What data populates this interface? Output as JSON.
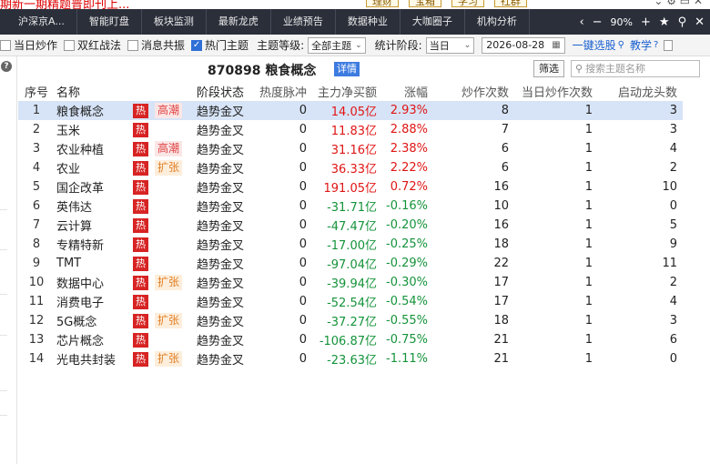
{
  "topbar": {
    "link": "期新一期精题普即刊上...",
    "buttons": [
      "理财",
      "宝箱",
      "学习",
      "社群"
    ]
  },
  "nav": {
    "tabs": [
      "沪深京A...",
      "智能盯盘",
      "板块监测",
      "最新龙虎",
      "业绩预告",
      "数据种业",
      "大咖圈子",
      "机构分析"
    ],
    "zoom": "90%"
  },
  "toolbar": {
    "checkboxes": [
      {
        "label": "当日炒作",
        "checked": false
      },
      {
        "label": "双红战法",
        "checked": false
      },
      {
        "label": "消息共振",
        "checked": false
      },
      {
        "label": "热门主题",
        "checked": true
      }
    ],
    "level_label": "主题等级:",
    "level_value": "全部主题",
    "stage_label": "统计阶段:",
    "stage_value": "当日",
    "date_value": "2026-08-28",
    "pick_label": "一键选股",
    "teach_label": "教学"
  },
  "title": {
    "text": "870898 粮食概念",
    "detail": "详情",
    "filter": "筛选",
    "search_placeholder": "搜索主题名称"
  },
  "table": {
    "headers": [
      "序号",
      "名称",
      "",
      "",
      "阶段状态",
      "热度脉冲",
      "主力净买额",
      "涨幅",
      "炒作次数",
      "当日炒作次数",
      "启动龙头数"
    ],
    "rows": [
      {
        "idx": "1",
        "name": "粮食概念",
        "hot": "热",
        "stage": "高潮",
        "stage_type": "hi",
        "status": "趋势金叉",
        "pulse": "0",
        "net": "14.05亿",
        "pct": "2.93%",
        "dir": "up",
        "times": "8",
        "today": "1",
        "leaders": "3",
        "selected": true
      },
      {
        "idx": "2",
        "name": "玉米",
        "hot": "热",
        "stage": "",
        "stage_type": "",
        "status": "趋势金叉",
        "pulse": "0",
        "net": "11.83亿",
        "pct": "2.88%",
        "dir": "up",
        "times": "7",
        "today": "1",
        "leaders": "3"
      },
      {
        "idx": "3",
        "name": "农业种植",
        "hot": "热",
        "stage": "高潮",
        "stage_type": "hi",
        "status": "趋势金叉",
        "pulse": "0",
        "net": "31.16亿",
        "pct": "2.38%",
        "dir": "up",
        "times": "6",
        "today": "1",
        "leaders": "4"
      },
      {
        "idx": "4",
        "name": "农业",
        "hot": "热",
        "stage": "扩张",
        "stage_type": "ex",
        "status": "趋势金叉",
        "pulse": "0",
        "net": "36.33亿",
        "pct": "2.22%",
        "dir": "up",
        "times": "6",
        "today": "1",
        "leaders": "2"
      },
      {
        "idx": "5",
        "name": "国企改革",
        "hot": "热",
        "stage": "",
        "stage_type": "",
        "status": "趋势金叉",
        "pulse": "0",
        "net": "191.05亿",
        "pct": "0.72%",
        "dir": "up",
        "times": "16",
        "today": "1",
        "leaders": "10"
      },
      {
        "idx": "6",
        "name": "英伟达",
        "hot": "热",
        "stage": "",
        "stage_type": "",
        "status": "趋势金叉",
        "pulse": "0",
        "net": "-31.71亿",
        "pct": "-0.16%",
        "dir": "down",
        "times": "10",
        "today": "1",
        "leaders": "0"
      },
      {
        "idx": "7",
        "name": "云计算",
        "hot": "热",
        "stage": "",
        "stage_type": "",
        "status": "趋势金叉",
        "pulse": "0",
        "net": "-47.47亿",
        "pct": "-0.20%",
        "dir": "down",
        "times": "16",
        "today": "1",
        "leaders": "5"
      },
      {
        "idx": "8",
        "name": "专精特新",
        "hot": "热",
        "stage": "",
        "stage_type": "",
        "status": "趋势金叉",
        "pulse": "0",
        "net": "-17.00亿",
        "pct": "-0.25%",
        "dir": "down",
        "times": "18",
        "today": "1",
        "leaders": "9"
      },
      {
        "idx": "9",
        "name": "TMT",
        "hot": "热",
        "stage": "",
        "stage_type": "",
        "status": "趋势金叉",
        "pulse": "0",
        "net": "-97.04亿",
        "pct": "-0.29%",
        "dir": "down",
        "times": "22",
        "today": "1",
        "leaders": "11"
      },
      {
        "idx": "10",
        "name": "数据中心",
        "hot": "热",
        "stage": "扩张",
        "stage_type": "ex",
        "status": "趋势金叉",
        "pulse": "0",
        "net": "-39.94亿",
        "pct": "-0.30%",
        "dir": "down",
        "times": "17",
        "today": "1",
        "leaders": "2"
      },
      {
        "idx": "11",
        "name": "消费电子",
        "hot": "热",
        "stage": "",
        "stage_type": "",
        "status": "趋势金叉",
        "pulse": "0",
        "net": "-52.54亿",
        "pct": "-0.54%",
        "dir": "down",
        "times": "17",
        "today": "1",
        "leaders": "4"
      },
      {
        "idx": "12",
        "name": "5G概念",
        "hot": "热",
        "stage": "扩张",
        "stage_type": "ex",
        "status": "趋势金叉",
        "pulse": "0",
        "net": "-37.27亿",
        "pct": "-0.55%",
        "dir": "down",
        "times": "18",
        "today": "1",
        "leaders": "3"
      },
      {
        "idx": "13",
        "name": "芯片概念",
        "hot": "热",
        "stage": "",
        "stage_type": "",
        "status": "趋势金叉",
        "pulse": "0",
        "net": "-106.87亿",
        "pct": "-0.75%",
        "dir": "down",
        "times": "21",
        "today": "1",
        "leaders": "6"
      },
      {
        "idx": "14",
        "name": "光电共封装",
        "hot": "热",
        "stage": "扩张",
        "stage_type": "ex",
        "status": "趋势金叉",
        "pulse": "0",
        "net": "-23.63亿",
        "pct": "-1.11%",
        "dir": "down",
        "times": "21",
        "today": "1",
        "leaders": "0"
      }
    ]
  },
  "colors": {
    "up": "#e01515",
    "down": "#14933a",
    "accent": "#2f6fd6",
    "hot": "#d72323"
  }
}
